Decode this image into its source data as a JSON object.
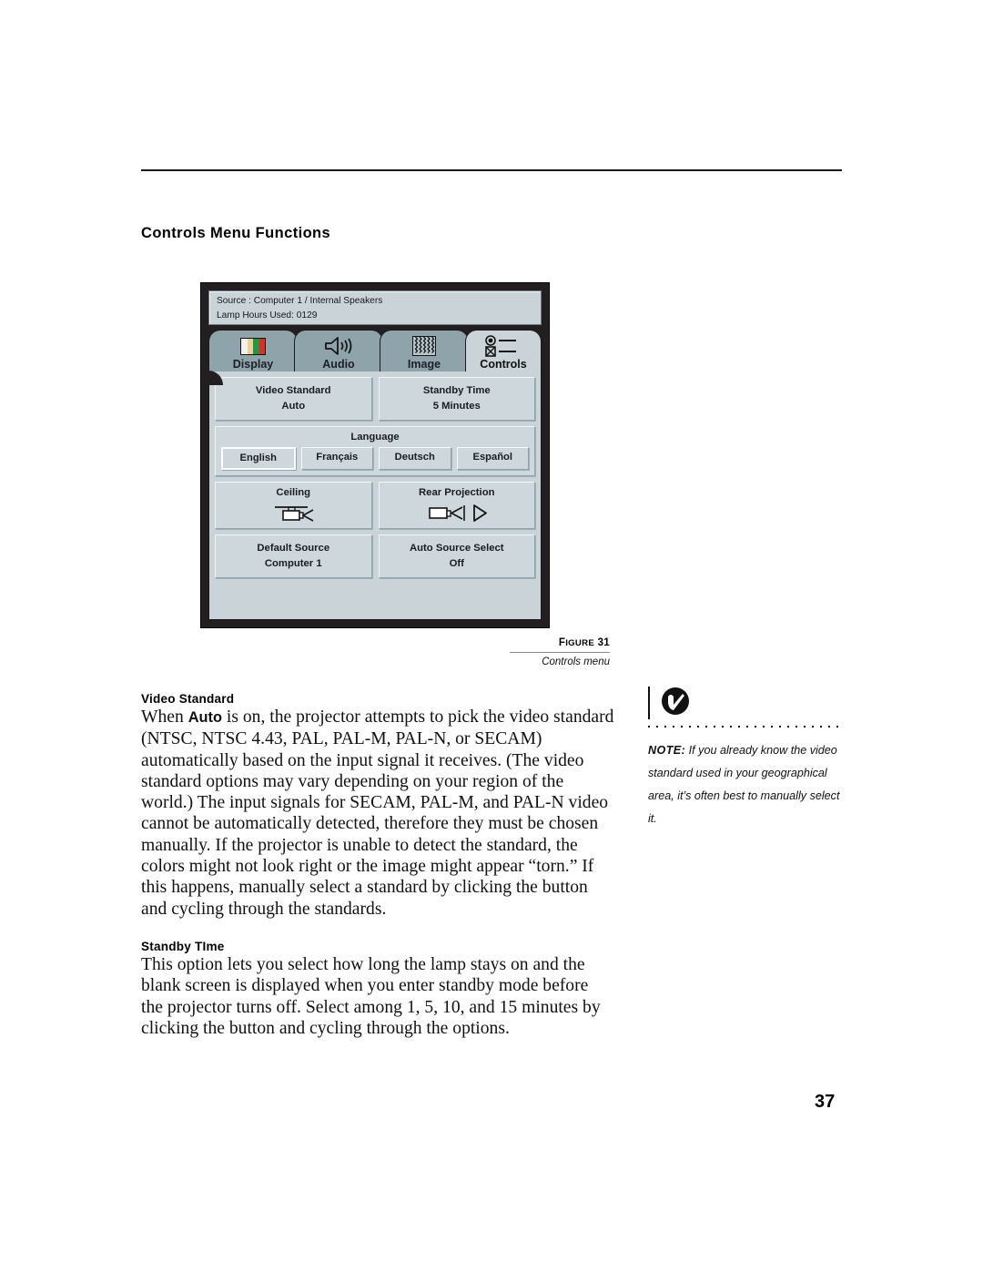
{
  "page": {
    "number": "37",
    "section_title": "Controls Menu Functions"
  },
  "osd": {
    "status": {
      "line1": "Source : Computer 1 / Internal Speakers",
      "line2": "Lamp Hours Used: 0129"
    },
    "tabs": [
      {
        "label": "Display",
        "icon": "color-bars-icon",
        "active": false
      },
      {
        "label": "Audio",
        "icon": "speaker-icon",
        "active": false
      },
      {
        "label": "Image",
        "icon": "zigzag-pattern-icon",
        "active": false
      },
      {
        "label": "Controls",
        "icon": "radio-checkbox-icon",
        "active": true
      }
    ],
    "buttons": {
      "video_standard": {
        "title": "Video Standard",
        "value": "Auto"
      },
      "standby_time": {
        "title": "Standby Time",
        "value": "5 Minutes"
      },
      "ceiling": {
        "title": "Ceiling",
        "icon": "ceiling-projector-icon"
      },
      "rear_projection": {
        "title": "Rear Projection",
        "icon": "rear-projection-icon"
      },
      "default_source": {
        "title": "Default Source",
        "value": "Computer 1"
      },
      "auto_source_select": {
        "title": "Auto Source Select",
        "value": "Off"
      }
    },
    "language": {
      "title": "Language",
      "options": [
        "English",
        "Français",
        "Deutsch",
        "Español"
      ],
      "selected": "English"
    },
    "colors": {
      "frame": "#231f20",
      "panel": "#c9d3d8",
      "button": "#cdd7dc",
      "tab_inactive": "#8fa3ab",
      "tab_active": "#c9d3d8",
      "bar_white": "#f2f2ee",
      "bar_tan": "#f0cf92",
      "bar_green": "#1f9648",
      "bar_red": "#e32b22"
    }
  },
  "figure": {
    "label_prefix": "F",
    "label_rest": "IGURE",
    "number": "31",
    "caption": "Controls menu"
  },
  "content": {
    "video_standard": {
      "heading": "Video Standard",
      "text_before_bold": "When ",
      "bold_word": "Auto",
      "text_after_bold": " is on, the projector attempts to pick the video standard (NTSC, NTSC 4.43, PAL, PAL-M, PAL-N, or SECAM) automatically based on the input signal it receives. (The video standard options may vary depending on your region of the world.) The input signals for SECAM, PAL-M, and PAL-N video cannot be automatically detected, therefore they must be chosen manually. If the projector is unable to detect the standard, the colors might not look right or the image might appear “torn.” If this happens, manually select a standard by clicking the button and cycling through the standards."
    },
    "standby_time": {
      "heading": "Standby TIme",
      "text": "This option lets you select how long the lamp stays on and the blank screen is displayed when you enter standby mode before the projector turns off. Select among 1, 5, 10, and 15 minutes by clicking the button and cycling through the options."
    }
  },
  "note": {
    "label": "NOTE:",
    "text": " If you already know the video standard used in your geographical area, it’s often best to manually select it.",
    "icon": "note-bolt-icon"
  }
}
